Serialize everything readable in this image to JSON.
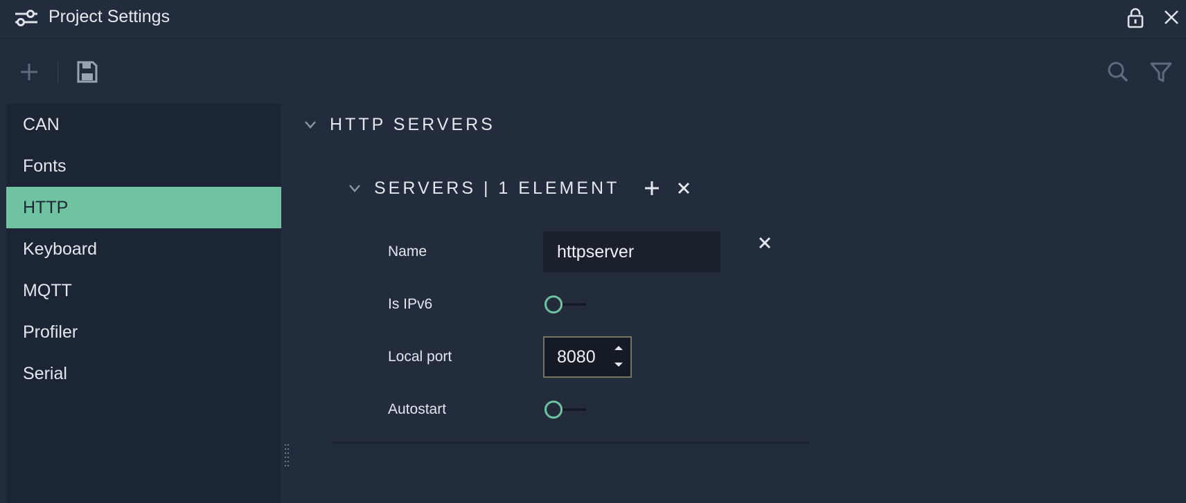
{
  "window": {
    "title": "Project Settings",
    "icons": {
      "title": "settings-sliders-icon",
      "lock": "lock-icon",
      "close": "close-icon"
    }
  },
  "toolbar": {
    "icons": [
      "plus-icon",
      "save-icon",
      "search-icon",
      "filter-icon"
    ]
  },
  "sidebar": {
    "items": [
      {
        "label": "CAN",
        "active": false
      },
      {
        "label": "Fonts",
        "active": false
      },
      {
        "label": "HTTP",
        "active": true
      },
      {
        "label": "Keyboard",
        "active": false
      },
      {
        "label": "MQTT",
        "active": false
      },
      {
        "label": "Profiler",
        "active": false
      },
      {
        "label": "Serial",
        "active": false
      }
    ]
  },
  "content": {
    "section_title": "HTTP SERVERS",
    "servers_header": "SERVERS | 1 ELEMENT",
    "fields": {
      "name_label": "Name",
      "name_value": "httpserver",
      "ipv6_label": "Is IPv6",
      "ipv6_on": false,
      "port_label": "Local port",
      "port_value": "8080",
      "autostart_label": "Autostart",
      "autostart_on": false
    }
  },
  "colors": {
    "background": "#222c3c",
    "sidebar_bg": "#1c2533",
    "accent": "#6fc3a1",
    "text": "#e4e8ee",
    "muted_icon": "#5f6b7d"
  }
}
